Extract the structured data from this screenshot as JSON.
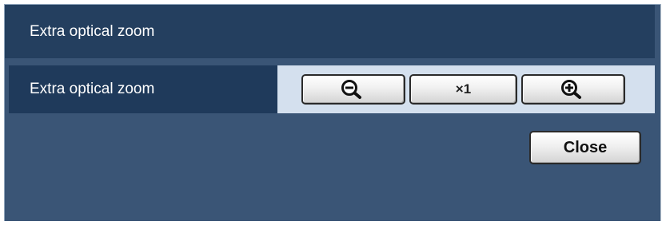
{
  "dialog": {
    "header_title": "Extra optical zoom"
  },
  "zoom_row": {
    "label": "Extra optical zoom",
    "zoom_out_icon": "zoom-out-magnifier-icon",
    "reset_label": "×1",
    "zoom_in_icon": "zoom-in-magnifier-icon"
  },
  "footer": {
    "close_label": "Close"
  },
  "colors": {
    "frame_bg": "#3a5576",
    "header_bg": "#243f5f",
    "label_bg": "#1f3a5b",
    "controls_bg": "#d4e0ee",
    "text_light": "#ffffff"
  }
}
